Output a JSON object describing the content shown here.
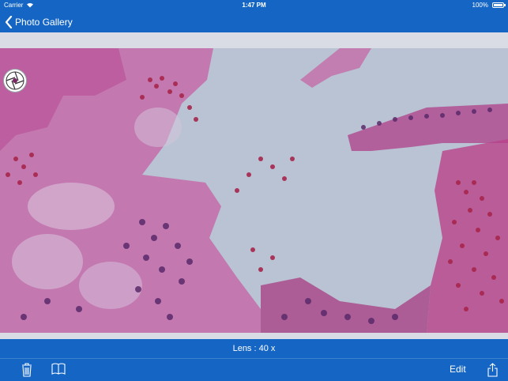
{
  "status_bar": {
    "carrier": "Carrier",
    "time": "1:47 PM",
    "battery_percent": "100%"
  },
  "nav": {
    "back_label": "Photo Gallery"
  },
  "lens_bar": {
    "text": "Lens : 40 x"
  },
  "toolbar": {
    "edit_label": "Edit",
    "icons": [
      "trash-icon",
      "book-icon",
      "share-icon"
    ]
  },
  "colors": {
    "bar_blue": "#1566c4",
    "tissue_bg": "#b7c2d2",
    "tissue_pink": "#c86aa8",
    "cell_red": "#a8254c",
    "nucleus_purple": "#5b2a6b"
  }
}
